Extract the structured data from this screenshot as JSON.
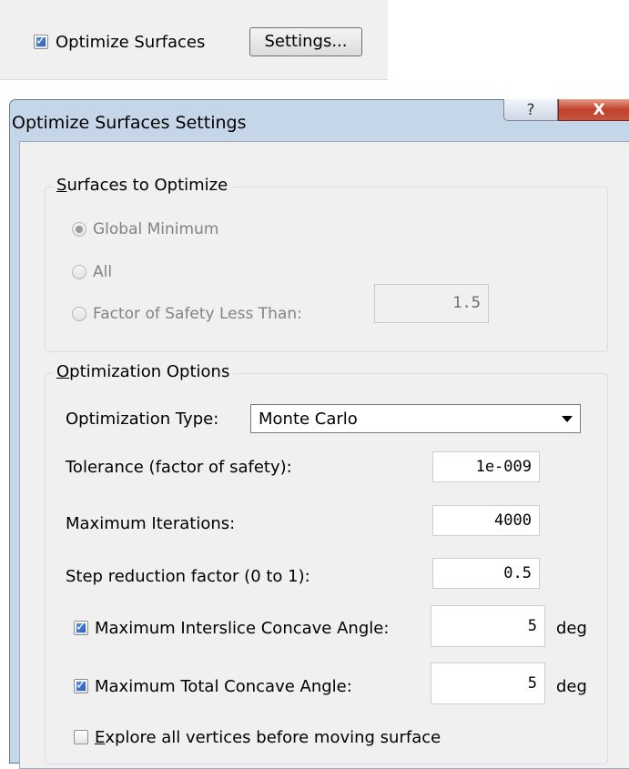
{
  "top": {
    "optimize_checkbox_label": "Optimize Surfaces",
    "optimize_checked": true,
    "settings_button": "Settings..."
  },
  "dialog": {
    "title": "Optimize Surfaces Settings",
    "help_glyph": "?",
    "close_glyph": "X",
    "surfaces_group": {
      "title_mnemonic": "S",
      "title_rest": "urfaces to Optimize",
      "options": [
        {
          "label": "Global Minimum",
          "selected": true
        },
        {
          "label": "All",
          "selected": false
        },
        {
          "label": "Factor of Safety Less Than:",
          "selected": false
        }
      ],
      "fos_value": "1.5"
    },
    "options_group": {
      "title_mnemonic": "O",
      "title_rest": "ptimization Options",
      "type_label": "Optimization Type:",
      "type_value": "Monte Carlo",
      "tolerance_label": "Tolerance (factor of safety):",
      "tolerance_value": "1e-009",
      "iterations_label": "Maximum Iterations:",
      "iterations_value": "4000",
      "step_label": "Step reduction factor (0 to 1):",
      "step_value": "0.5",
      "interslice_label": "Maximum Interslice Concave Angle:",
      "interslice_checked": true,
      "interslice_value": "5",
      "total_label": "Maximum Total Concave Angle:",
      "total_checked": true,
      "total_value": "5",
      "deg_unit": "deg",
      "explore_mnemonic": "E",
      "explore_rest": "xplore all vertices before moving surface",
      "explore_checked": false
    }
  }
}
